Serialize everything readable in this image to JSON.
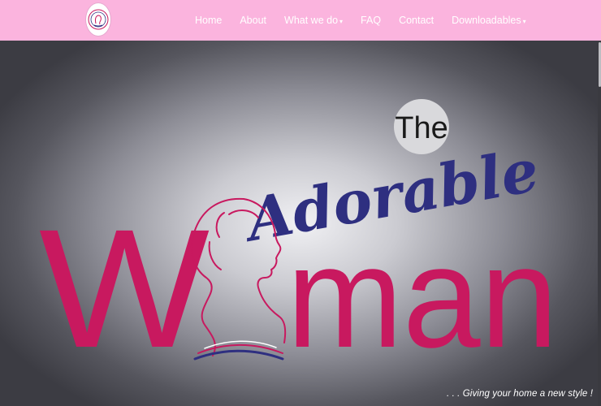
{
  "logo": {
    "icon": "adorable-woman-circle-logo"
  },
  "nav": {
    "home": "Home",
    "about": "About",
    "what_we_do": "What we do",
    "faq": "FAQ",
    "contact": "Contact",
    "downloadables": "Downloadables",
    "caret": "▾"
  },
  "hero": {
    "brand_the": "The",
    "brand_adorable": "Adorable",
    "brand_w": "W",
    "brand_man": "man",
    "tagline": ". . . Giving your home a new style !"
  },
  "colors": {
    "navbar": "#fbb4de",
    "magenta": "#c8195f",
    "navy": "#2e2f80",
    "line_pink": "#c8195f"
  }
}
